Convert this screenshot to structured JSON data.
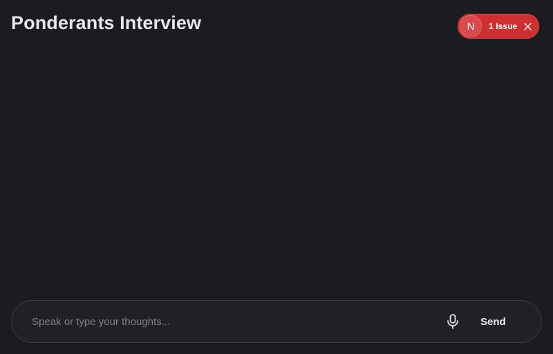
{
  "header": {
    "title": "Ponderants Interview"
  },
  "issue_toast": {
    "avatar_letter": "N",
    "label": "1 Issue",
    "background": "#d02f30"
  },
  "composer": {
    "placeholder": "Speak or type your thoughts...",
    "value": "",
    "mic_icon": "microphone-icon",
    "send_label": "Send"
  }
}
